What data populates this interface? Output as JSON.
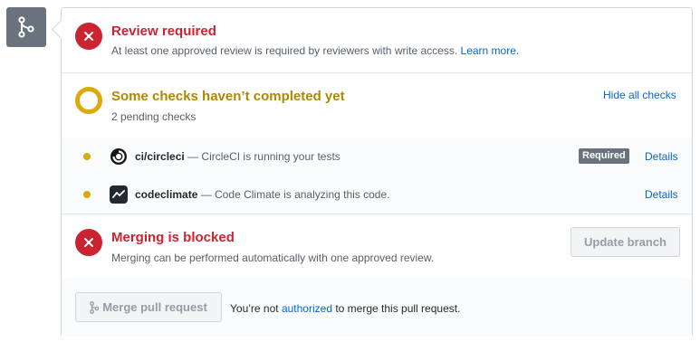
{
  "review": {
    "title": "Review required",
    "description": "At least one approved review is required by reviewers with write access.",
    "learn_more": "Learn more."
  },
  "checks": {
    "title": "Some checks haven’t completed yet",
    "subtitle": "2 pending checks",
    "toggle_label": "Hide all checks",
    "items": [
      {
        "name": "ci/circleci",
        "description": "— CircleCI is running your tests",
        "badge": "Required",
        "details_label": "Details",
        "status": "pending"
      },
      {
        "name": "codeclimate",
        "description": "— Code Climate is analyzing this code.",
        "details_label": "Details",
        "status": "pending"
      }
    ]
  },
  "blocked": {
    "title": "Merging is blocked",
    "description": "Merging can be performed automatically with one approved review.",
    "update_button": "Update branch"
  },
  "merge": {
    "button_label": "Merge pull request",
    "note_prefix": "You’re not",
    "note_link": "authorized",
    "note_suffix": "to merge this pull request."
  },
  "colors": {
    "danger": "#cb2431",
    "pending": "#dbab09",
    "pending_text": "#b08800",
    "link": "#0366d6",
    "muted": "#586069"
  },
  "icons": {
    "badge": "git-merge-icon",
    "review_status": "x-icon",
    "checks_status": "pending-ring-icon",
    "blocked_status": "x-icon"
  }
}
